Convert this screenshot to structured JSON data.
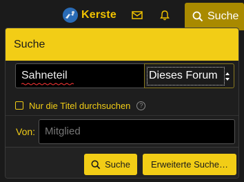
{
  "topbar": {
    "username": "Kerste",
    "search_tab_label": "Suche",
    "icons": [
      "avatar",
      "envelope-icon",
      "bell-icon",
      "search-icon"
    ]
  },
  "panel": {
    "title": "Suche",
    "search_value": "Sahneteil",
    "scope_select": "Dieses Forum",
    "titles_only_label": "Nur die Titel durchsuchen",
    "titles_only_checked": false,
    "member_label": "Von:",
    "member_placeholder": "Mitglied",
    "search_button": "Suche",
    "advanced_button": "Erweiterte Suche…"
  },
  "colors": {
    "accent": "#f2cd16",
    "accent_dark": "#a98a00",
    "background": "#1e1e1e"
  }
}
